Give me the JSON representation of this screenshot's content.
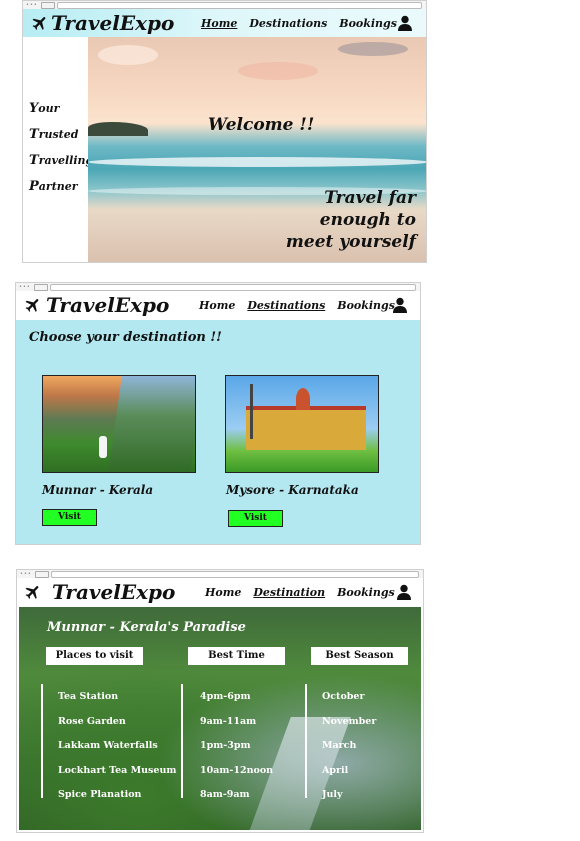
{
  "screens": [
    {
      "brand": "TravelExpo",
      "nav": [
        "Home",
        "Destinations",
        "Bookings"
      ],
      "active": 0,
      "side_words": [
        {
          "cap": "Y",
          "rest": "our"
        },
        {
          "cap": "T",
          "rest": "rusted"
        },
        {
          "cap": "T",
          "rest": "ravelling"
        },
        {
          "cap": "P",
          "rest": "artner"
        }
      ],
      "welcome": "Welcome !!",
      "tagline": [
        "Travel far",
        "enough to",
        "meet yourself"
      ]
    },
    {
      "brand": "TravelExpo",
      "nav": [
        "Home",
        "Destinations",
        "Bookings"
      ],
      "active": 1,
      "heading": "Choose your destination !!",
      "cards": [
        {
          "title": "Munnar - Kerala",
          "button": "Visit"
        },
        {
          "title": "Mysore - Karnataka",
          "button": "Visit"
        }
      ]
    },
    {
      "brand": "TravelExpo",
      "nav": [
        "Home",
        "Destination",
        "Bookings"
      ],
      "active": 1,
      "heading": "Munnar - Kerala's Paradise",
      "columns": [
        {
          "header": "Places to visit",
          "items": [
            "Tea Station",
            "Rose Garden",
            "Lakkam Waterfalls",
            "Lockhart Tea Museum",
            "Spice Planation"
          ]
        },
        {
          "header": "Best Time",
          "items": [
            "4pm-6pm",
            "9am-11am",
            "1pm-3pm",
            "10am-12noon",
            "8am-9am"
          ]
        },
        {
          "header": "Best Season",
          "items": [
            "October",
            "November",
            "March",
            "April",
            "July"
          ]
        }
      ]
    }
  ],
  "colors": {
    "visit_button": "#22ff22",
    "panel_bg": "#b3e8f0"
  },
  "icons": [
    "airplane-icon",
    "user-icon"
  ]
}
